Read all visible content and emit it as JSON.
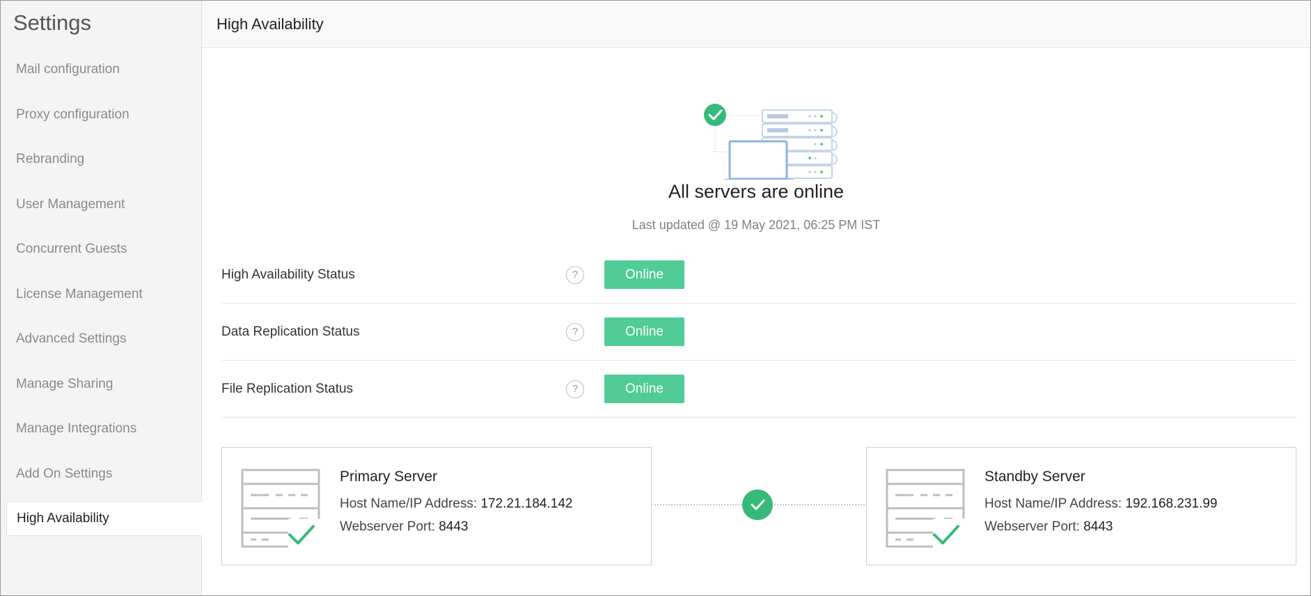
{
  "sidebar": {
    "title": "Settings",
    "items": [
      {
        "label": "Mail configuration"
      },
      {
        "label": "Proxy configuration"
      },
      {
        "label": "Rebranding"
      },
      {
        "label": "User Management"
      },
      {
        "label": "Concurrent Guests"
      },
      {
        "label": "License Management"
      },
      {
        "label": "Advanced Settings"
      },
      {
        "label": "Manage Sharing"
      },
      {
        "label": "Manage Integrations"
      },
      {
        "label": "Add On Settings"
      },
      {
        "label": "High Availability"
      }
    ],
    "active_item": "High Availability"
  },
  "header": {
    "title": "High Availability"
  },
  "hero": {
    "title": "All servers are online",
    "last_updated": "Last updated @ 19 May 2021, 06:25 PM IST",
    "icon": "servers-online-illustration"
  },
  "statuses": [
    {
      "label": "High Availability Status",
      "help": "?",
      "value": "Online"
    },
    {
      "label": "Data Replication Status",
      "help": "?",
      "value": "Online"
    },
    {
      "label": "File Replication Status",
      "help": "?",
      "value": "Online"
    }
  ],
  "servers": {
    "primary": {
      "name": "Primary Server",
      "host_label": "Host Name/IP Address:",
      "host_value": "172.21.184.142",
      "port_label": "Webserver Port:",
      "port_value": "8443"
    },
    "standby": {
      "name": "Standby Server",
      "host_label": "Host Name/IP Address:",
      "host_value": "192.168.231.99",
      "port_label": "Webserver Port:",
      "port_value": "8443"
    },
    "connection_icon": "check-circle-icon"
  },
  "colors": {
    "online_pill": "#51cc96",
    "check_green": "#37ba79",
    "sidebar_bg": "#f4f4f4",
    "header_bg": "#f8f8f8"
  }
}
